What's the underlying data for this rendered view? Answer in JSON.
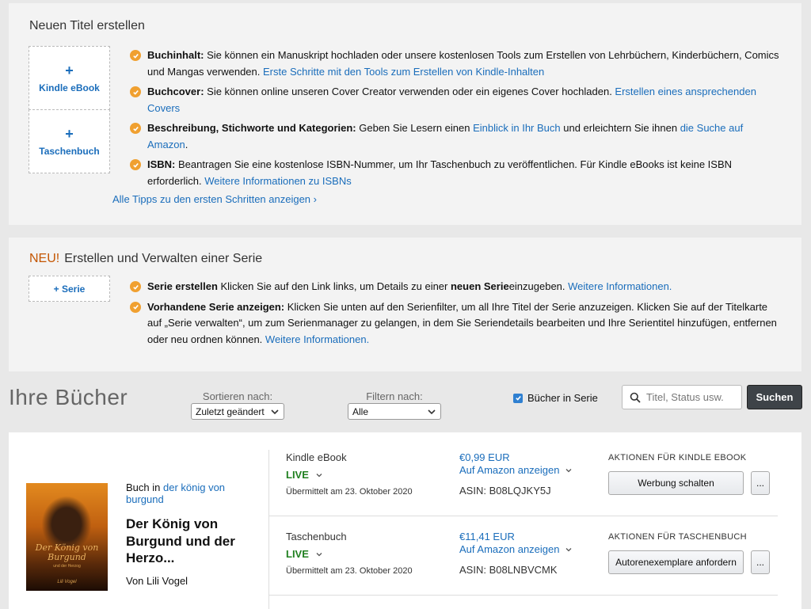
{
  "new_title": {
    "heading": "Neuen Titel erstellen",
    "kindle_plus": "+",
    "kindle_label": "Kindle eBook",
    "paper_plus": "+",
    "paper_label": "Taschenbuch",
    "tips": [
      {
        "bold": "Buchinhalt:",
        "text": " Sie können ein Manuskript hochladen oder unsere kostenlosen Tools zum Erstellen von Lehrbüchern, Kinderbüchern, Comics und Mangas verwenden. ",
        "link": "Erste Schritte mit den Tools zum Erstellen von Kindle-Inhalten"
      },
      {
        "bold": "Buchcover:",
        "text": " Sie können online unseren Cover Creator verwenden oder ein eigenes Cover hochladen. ",
        "link": "Erstellen eines ansprechenden Covers"
      },
      {
        "bold": "Beschreibung, Stichworte und Kategorien:",
        "text": " Geben Sie Lesern einen ",
        "link": "Einblick in Ihr Buch",
        "text2": " und erleichtern Sie ihnen ",
        "link2": "die Suche auf Amazon",
        "text3": "."
      },
      {
        "bold": "ISBN:",
        "text": " Beantragen Sie eine kostenlose ISBN-Nummer, um Ihr Taschenbuch zu veröffentlichen. Für Kindle eBooks ist keine ISBN erforderlich. ",
        "link": "Weitere Informationen zu ISBNs"
      }
    ],
    "all_tips": "Alle Tipps zu den ersten Schritten anzeigen ›"
  },
  "series": {
    "new_tag": "NEU!",
    "heading": "Erstellen und Verwalten einer Serie",
    "create_label": "+ Serie",
    "tips": [
      {
        "bold": "Serie erstellen",
        "text": " Klicken Sie auf den Link links, um Details zu einer ",
        "bold2": "neuen Serie",
        "text2": "einzugeben. ",
        "link": "Weitere Informationen."
      },
      {
        "bold": "Vorhandene Serie anzeigen:",
        "text": " Klicken Sie unten auf den Serienfilter, um all Ihre Titel der Serie anzuzeigen. Klicken Sie auf der Titelkarte auf „Serie verwalten“, um zum Serienmanager zu gelangen, in dem Sie Seriendetails bearbeiten und Ihre Serientitel hinzufügen, entfernen oder neu ordnen können. ",
        "link": "Weitere Informationen."
      }
    ]
  },
  "books": {
    "heading": "Ihre Bücher",
    "sort_label": "Sortieren nach:",
    "sort_value": "Zuletzt geändert",
    "filter_label": "Filtern nach:",
    "filter_value": "Alle",
    "series_checkbox_label": "Bücher in Serie",
    "series_checkbox_checked": true,
    "search_placeholder": "Titel, Status usw.",
    "search_button": "Suchen"
  },
  "book": {
    "series_prefix": "Buch in ",
    "series_link": "der könig von burgund",
    "title": "Der König von Burgund und der Herzo...",
    "author": "Von Lili Vogel",
    "cover_title": "Der König von Burgund",
    "cover_subtitle": "und der Herzog",
    "cover_author": "Lili Vogel",
    "formats": [
      {
        "name": "Kindle eBook",
        "status": "LIVE",
        "date": "Übermittelt am 23. Oktober 2020",
        "price": "€0,99 EUR",
        "view": "Auf Amazon anzeigen",
        "asin": "ASIN: B08LQJKY5J",
        "actions_label": "AKTIONEN FÜR KINDLE EBOOK",
        "action_button": "Werbung schalten",
        "more": "..."
      },
      {
        "name": "Taschenbuch",
        "status": "LIVE",
        "date": "Übermittelt am 23. Oktober 2020",
        "price": "€11,41 EUR",
        "view": "Auf Amazon anzeigen",
        "asin": "ASIN: B08LNBVCMK",
        "actions_label": "AKTIONEN FÜR TASCHENBUCH",
        "action_button": "Autorenexemplare anfordern",
        "more": "..."
      }
    ]
  },
  "colors": {
    "link": "#1a6dbb",
    "live": "#208020",
    "check": "#f0a030",
    "new_tag": "#c45500"
  }
}
